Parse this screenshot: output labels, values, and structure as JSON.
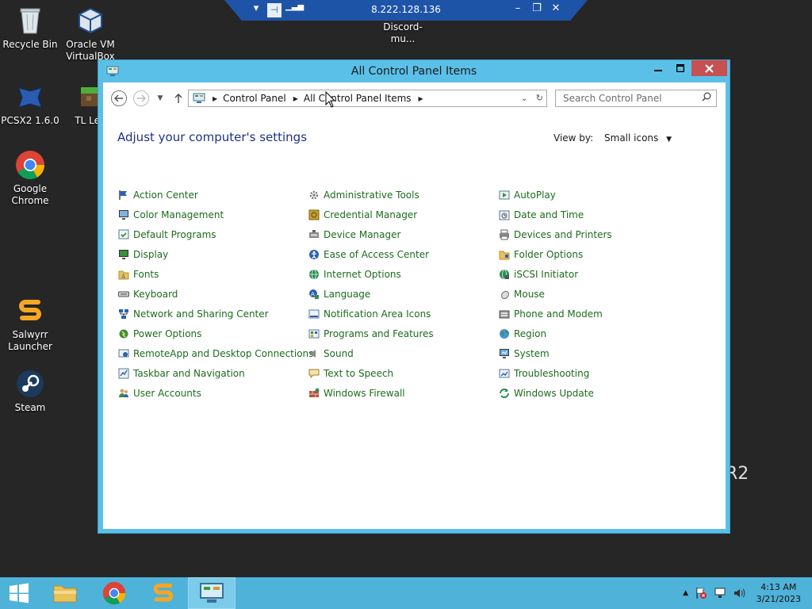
{
  "desktop": {
    "icons": [
      {
        "label": "Recycle Bin",
        "icon": "recycle-bin-icon"
      },
      {
        "label": "Oracle VM VirtualBox",
        "icon": "virtualbox-icon"
      },
      {
        "label": "PCSX2 1.6.0",
        "icon": "pcsx2-icon"
      },
      {
        "label": "TL Leg",
        "icon": "minecraft-launcher-icon"
      },
      {
        "label": "Google Chrome",
        "icon": "chrome-icon"
      },
      {
        "label": "Salwyrr Launcher",
        "icon": "salwyrr-icon"
      },
      {
        "label": "Steam",
        "icon": "steam-icon"
      },
      {
        "label": "Discord-mu...",
        "icon": "folder-icon"
      }
    ],
    "watermark": "R2"
  },
  "rdp_bar": {
    "title": "8.222.128.136"
  },
  "window": {
    "title": "All Control Panel Items",
    "breadcrumb": [
      "Control Panel",
      "All Control Panel Items"
    ],
    "search_placeholder": "Search Control Panel",
    "heading": "Adjust your computer's settings",
    "view_by_label": "View by:",
    "view_by_value": "Small icons",
    "columns": [
      [
        "Action Center",
        "Color Management",
        "Default Programs",
        "Display",
        "Fonts",
        "Keyboard",
        "Network and Sharing Center",
        "Power Options",
        "RemoteApp and Desktop Connections",
        "Taskbar and Navigation",
        "User Accounts"
      ],
      [
        "Administrative Tools",
        "Credential Manager",
        "Device Manager",
        "Ease of Access Center",
        "Internet Options",
        "Language",
        "Notification Area Icons",
        "Programs and Features",
        "Sound",
        "Text to Speech",
        "Windows Firewall"
      ],
      [
        "AutoPlay",
        "Date and Time",
        "Devices and Printers",
        "Folder Options",
        "iSCSI Initiator",
        "Mouse",
        "Phone and Modem",
        "Region",
        "System",
        "Troubleshooting",
        "Windows Update"
      ]
    ]
  },
  "taskbar": {
    "time": "4:13 AM",
    "date": "3/21/2023"
  },
  "colors": {
    "window_frame": "#5bc0e8",
    "taskbar": "#4fb2d9",
    "link_green": "#1c6b1c",
    "heading_blue": "#1e3287",
    "close_red": "#c75050"
  }
}
